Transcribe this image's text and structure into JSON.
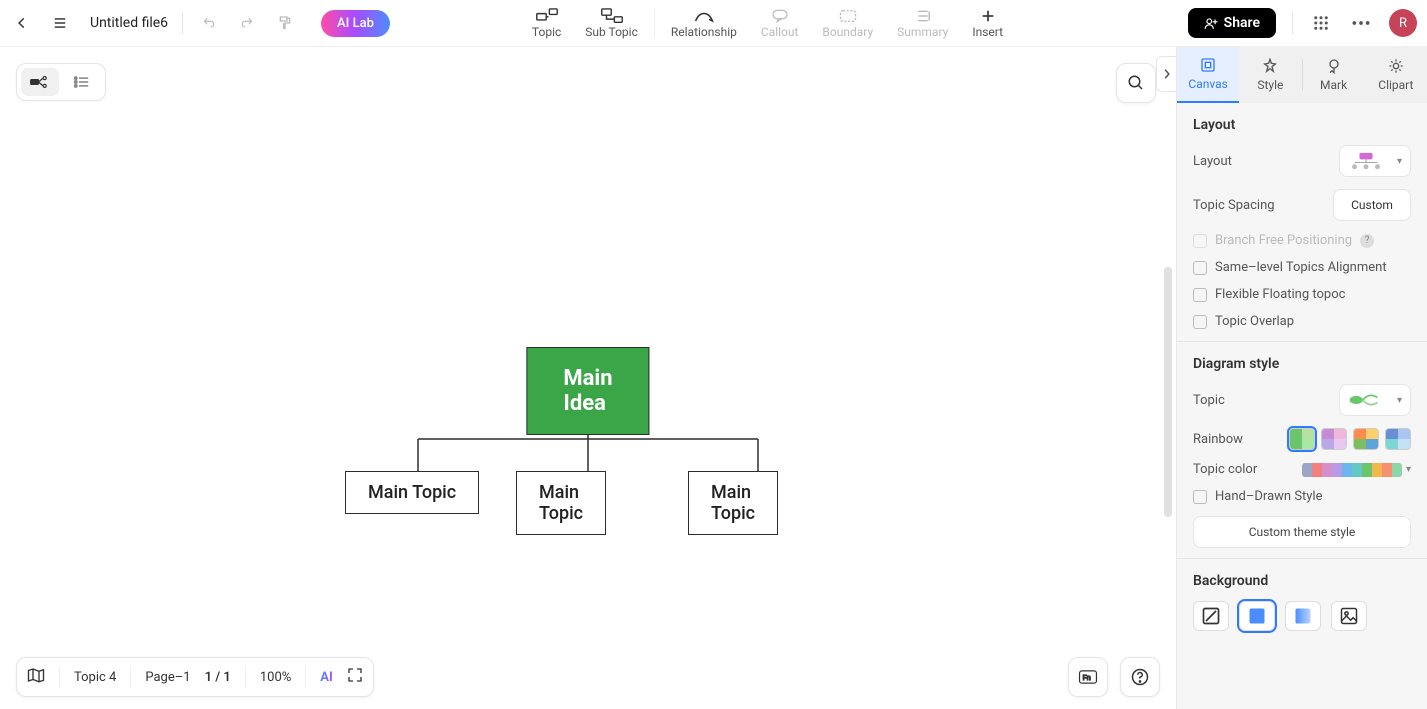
{
  "topbar": {
    "file_title": "Untitled file6",
    "ai_lab": "AI Lab",
    "items": [
      {
        "label": "Topic",
        "enabled": true
      },
      {
        "label": "Sub Topic",
        "enabled": true
      },
      {
        "label": "Relationship",
        "enabled": true
      },
      {
        "label": "Callout",
        "enabled": false
      },
      {
        "label": "Boundary",
        "enabled": false
      },
      {
        "label": "Summary",
        "enabled": false
      },
      {
        "label": "Insert",
        "enabled": true
      }
    ],
    "share": "Share",
    "avatar_letter": "R"
  },
  "mindmap": {
    "root": "Main Idea",
    "children": [
      "Main Topic",
      "Main Topic",
      "Main Topic"
    ]
  },
  "bottombar": {
    "topic_count": "Topic 4",
    "page_label": "Page–1",
    "page_num": "1 / 1",
    "zoom": "100%",
    "ai": "AI"
  },
  "panel": {
    "tabs": [
      "Canvas",
      "Style",
      "Mark",
      "Clipart"
    ],
    "active_tab": 0,
    "layout_section": {
      "title": "Layout",
      "layout_label": "Layout",
      "spacing_label": "Topic Spacing",
      "spacing_value": "Custom",
      "branch_free": "Branch Free Positioning",
      "same_level": "Same–level Topics Alignment",
      "flexible": "Flexible Floating topoc",
      "overlap": "Topic Overlap"
    },
    "diagram_section": {
      "title": "Diagram style",
      "topic_label": "Topic",
      "rainbow_label": "Rainbow",
      "topic_color_label": "Topic color",
      "hand_drawn": "Hand–Drawn Style",
      "custom_theme": "Custom theme style",
      "rainbow_palettes": [
        [
          "#6bc66b",
          "#b7e0a0",
          "#6bc66b",
          "#a8e6a3"
        ],
        [
          "#c78bd6",
          "#f0b8d8",
          "#b8a8e6",
          "#e8c8f0"
        ],
        [
          "#ff8c4d",
          "#ffcf6b",
          "#7bbf5f",
          "#5fa4d6"
        ],
        [
          "#6b8fd6",
          "#a8c6f0",
          "#7bd6d6",
          "#c6e0f5"
        ]
      ],
      "topic_colors": [
        "#9aa6c4",
        "#f28080",
        "#d68fc8",
        "#b89be6",
        "#6bb5f0",
        "#64c9c4",
        "#6bc66b",
        "#f2b84d",
        "#f59073",
        "#8cd6a8"
      ]
    },
    "background_section": {
      "title": "Background"
    }
  }
}
